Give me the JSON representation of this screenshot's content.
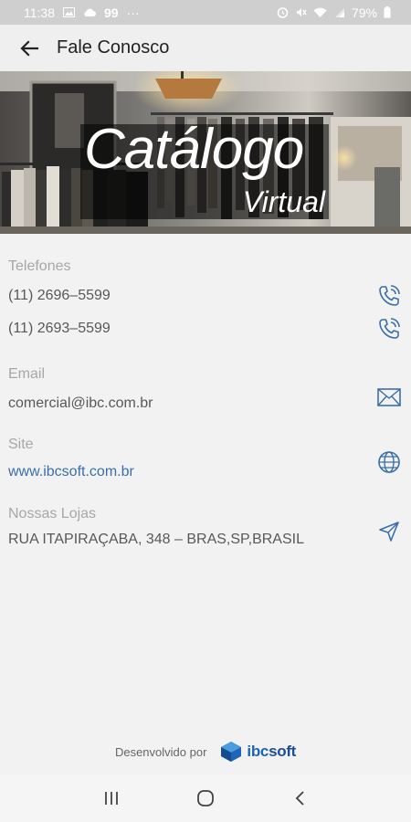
{
  "status_bar": {
    "time": "11:38",
    "battery": "79%",
    "notif_count": "99",
    "more": "···"
  },
  "header": {
    "title": "Fale Conosco",
    "back_icon": "arrow-left-icon"
  },
  "banner": {
    "title": "Catálogo",
    "subtitle": "Virtual"
  },
  "contact": {
    "phones_label": "Telefones",
    "phones": [
      "(11) 2696–5599",
      "(11) 2693–5599"
    ],
    "email_label": "Email",
    "email": "comercial@ibc.com.br",
    "site_label": "Site",
    "site": "www.ibcsoft.com.br",
    "stores_label": "Nossas Lojas",
    "store_address": "RUA ITAPIRAÇABA, 348 – BRAS,SP,BRASIL"
  },
  "footer": {
    "developed_by": "Desenvolvido por",
    "brand_ibc": "ibc",
    "brand_soft": "soft"
  },
  "colors": {
    "accent": "#3a6fa9",
    "brand": "#1d66b5",
    "status_bar": "#cfcfcf",
    "app_bar": "#efefef",
    "background": "#f2f2f2"
  }
}
